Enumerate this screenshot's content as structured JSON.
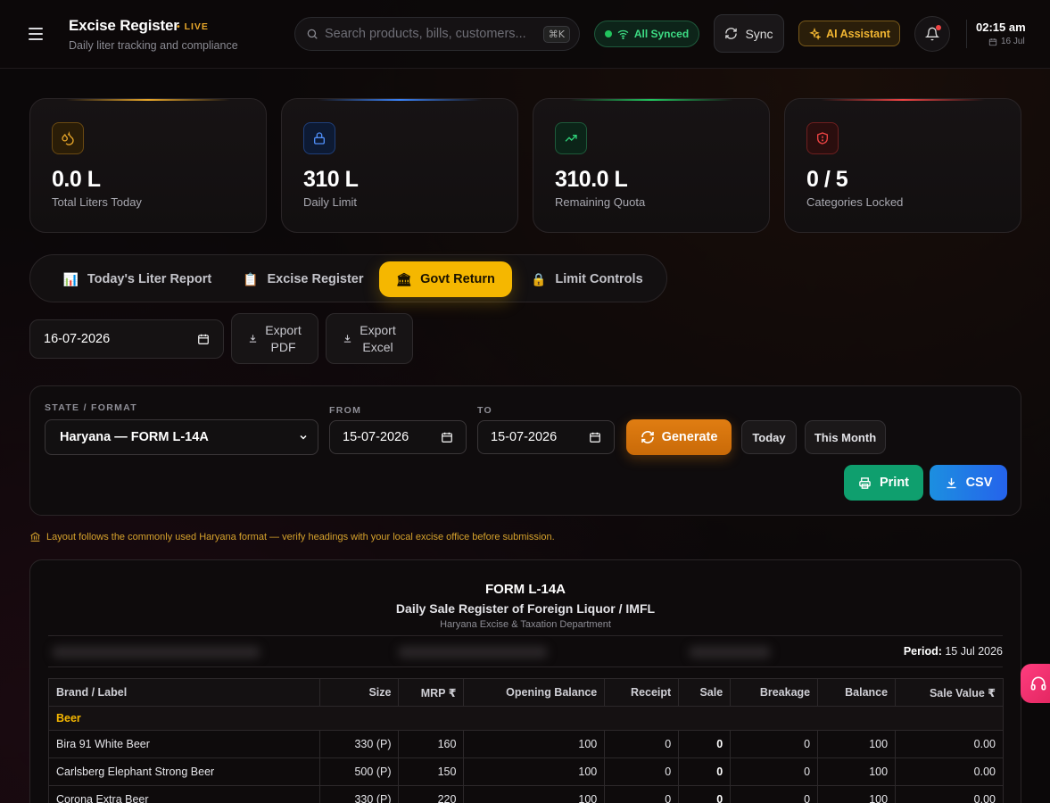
{
  "header": {
    "title": "Excise Register",
    "live": "LIVE",
    "subtitle": "Daily liter tracking and compliance",
    "search_placeholder": "Search products, bills, customers...",
    "search_shortcut": "⌘K",
    "sync_status": "All Synced",
    "sync_label": "Sync",
    "ai_label": "AI Assistant",
    "time": "02:15 am",
    "date": "16 Jul"
  },
  "stats": [
    {
      "value": "0.0 L",
      "label": "Total Liters Today",
      "accent": "#e8a72a"
    },
    {
      "value": "310 L",
      "label": "Daily Limit",
      "accent": "#3b82f6"
    },
    {
      "value": "310.0 L",
      "label": "Remaining Quota",
      "accent": "#22c55e"
    },
    {
      "value": "0 / 5",
      "label": "Categories Locked",
      "accent": "#ef4444"
    }
  ],
  "tabs": [
    {
      "label": "Today's Liter Report",
      "emoji": "📊"
    },
    {
      "label": "Excise Register",
      "emoji": "📋"
    },
    {
      "label": "Govt Return",
      "emoji": "🏛"
    },
    {
      "label": "Limit Controls",
      "emoji": "🔒"
    }
  ],
  "active_tab": "Govt Return",
  "toolbar": {
    "date": "16-07-2026",
    "export_pdf": [
      "Export",
      "PDF"
    ],
    "export_excel": [
      "Export",
      "Excel"
    ]
  },
  "filters": {
    "state_label": "STATE / FORMAT",
    "state_value": "Haryana — FORM L-14A",
    "from_label": "FROM",
    "from_value": "15-07-2026",
    "to_label": "TO",
    "to_value": "15-07-2026",
    "generate": "Generate",
    "today": "Today",
    "this_month": "This Month",
    "print": "Print",
    "csv": "CSV"
  },
  "note": "Layout follows the commonly used Haryana format — verify headings with your local excise office before submission.",
  "report": {
    "title": "FORM L-14A",
    "subtitle": "Daily Sale Register of Foreign Liquor / IMFL",
    "department": "Haryana Excise & Taxation Department",
    "period_label": "Period:",
    "period_value": "15 Jul 2026",
    "columns": [
      "Brand / Label",
      "Size",
      "MRP ₹",
      "Opening Balance",
      "Receipt",
      "Sale",
      "Breakage",
      "Balance",
      "Sale Value ₹"
    ],
    "category": "Beer",
    "rows": [
      [
        "Bira 91 White Beer",
        "330 (P)",
        "160",
        "100",
        "0",
        "0",
        "0",
        "100",
        "0.00"
      ],
      [
        "Carlsberg Elephant Strong Beer",
        "500 (P)",
        "150",
        "100",
        "0",
        "0",
        "0",
        "100",
        "0.00"
      ],
      [
        "Corona Extra Beer",
        "330 (P)",
        "220",
        "100",
        "0",
        "0",
        "0",
        "100",
        "0.00"
      ]
    ]
  }
}
